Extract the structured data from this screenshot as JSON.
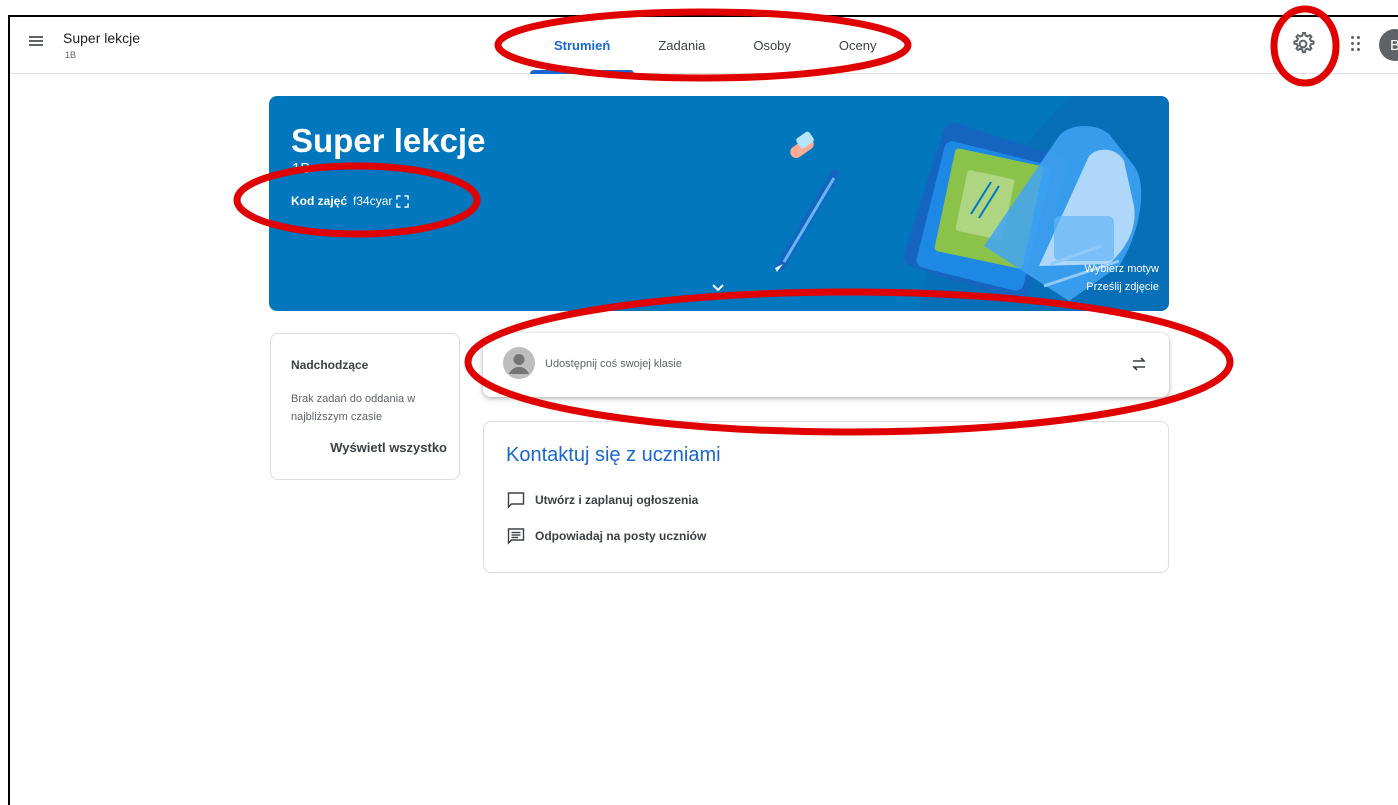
{
  "header": {
    "title": "Super lekcje",
    "subtitle": "1B",
    "avatar_letter": "B"
  },
  "tabs": [
    {
      "label": "Strumień",
      "active": true
    },
    {
      "label": "Zadania",
      "active": false
    },
    {
      "label": "Osoby",
      "active": false
    },
    {
      "label": "Oceny",
      "active": false
    }
  ],
  "banner": {
    "title": "Super lekcje",
    "subtitle": "1B",
    "class_code_label": "Kod zajęć",
    "class_code_value": "f34cyar",
    "choose_theme": "Wybierz motyw",
    "upload_photo": "Prześlij zdjęcie",
    "background_color": "#0277bd"
  },
  "upcoming": {
    "title": "Nadchodzące",
    "text": "Brak zadań do oddania w najbliższym czasie",
    "view_all": "Wyświetl wszystko"
  },
  "share": {
    "placeholder": "Udostępnij coś swojej klasie"
  },
  "contact": {
    "title": "Kontaktuj się z uczniami",
    "items": [
      {
        "label": "Utwórz i zaplanuj ogłoszenia",
        "icon": "announcement-icon"
      },
      {
        "label": "Odpowiadaj na posty uczniów",
        "icon": "comments-icon"
      }
    ]
  },
  "colors": {
    "accent": "#1967d2",
    "annotation": "#e00000"
  }
}
